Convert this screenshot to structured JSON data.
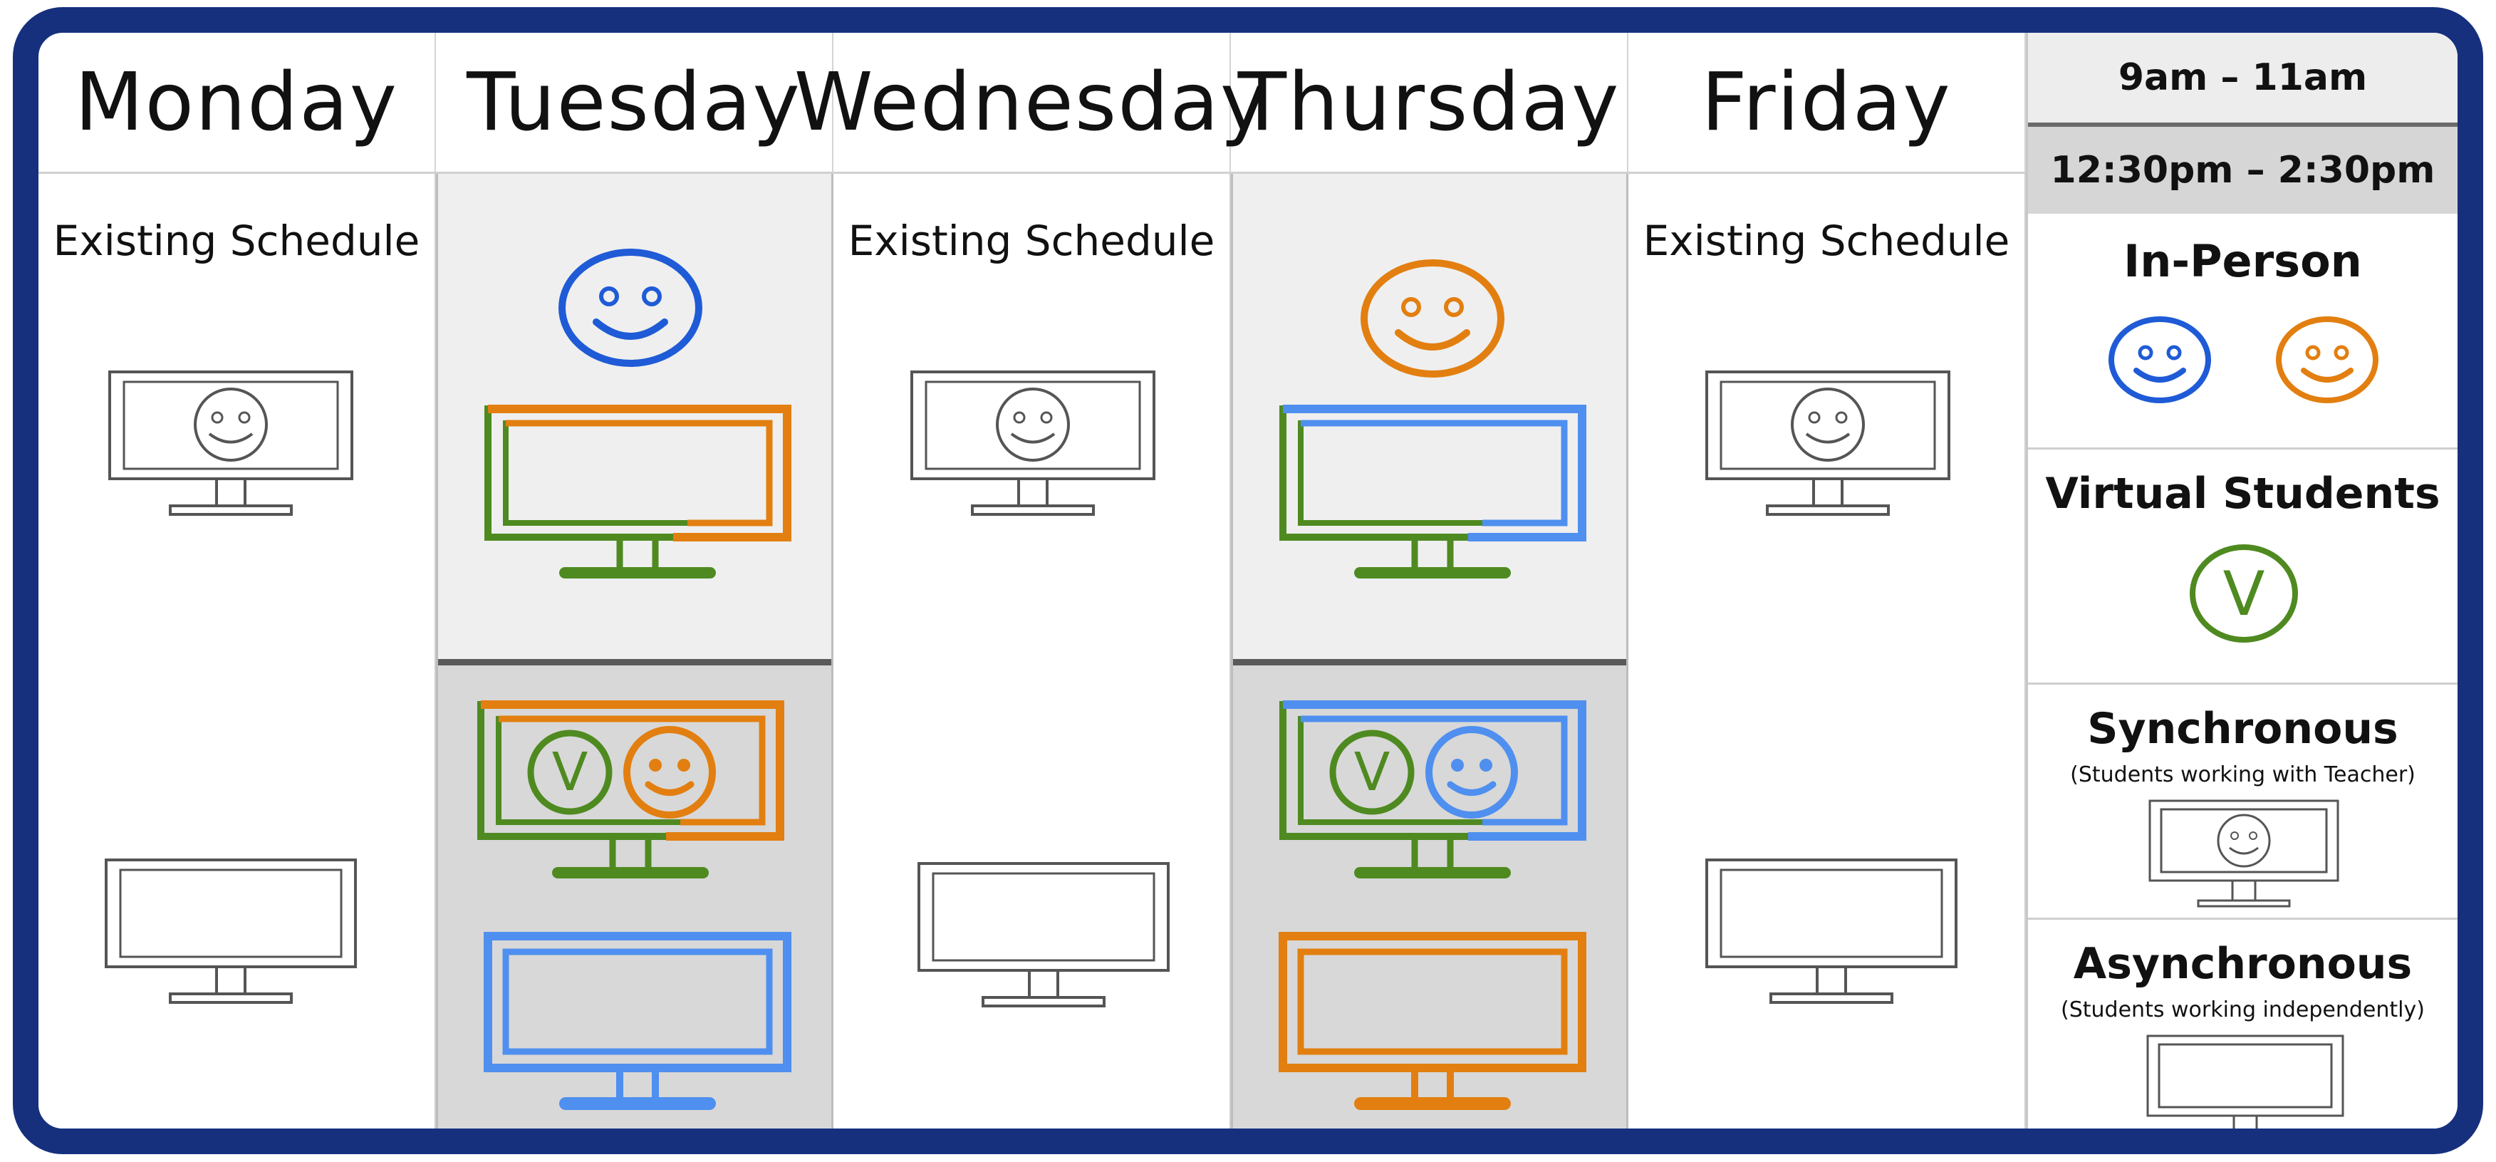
{
  "days": [
    "Monday",
    "Tuesday",
    "Wednesday",
    "Thursday",
    "Friday"
  ],
  "existing_schedule_label": "Existing Schedule",
  "legend": {
    "time_slot_1": "9am – 11am",
    "time_slot_2": "12:30pm – 2:30pm",
    "in_person_title": "In-Person",
    "virtual_title": "Virtual Students",
    "virtual_badge_letter": "V",
    "synchronous_title": "Synchronous",
    "synchronous_sub": "(Students working with Teacher)",
    "asynchronous_title": "Asynchronous",
    "asynchronous_sub": "(Students working independently)"
  },
  "colors": {
    "frame": "#16307e",
    "blue": "#1f5bd6",
    "orange": "#e27f10",
    "green": "#4f8a21",
    "light_blue": "#4f8fef",
    "gray_outline": "#555555"
  },
  "icons": {
    "in_person": "smiley-face-icon",
    "virtual": "v-circle-icon",
    "synchronous": "monitor-with-face-icon",
    "asynchronous": "blank-monitor-icon"
  }
}
